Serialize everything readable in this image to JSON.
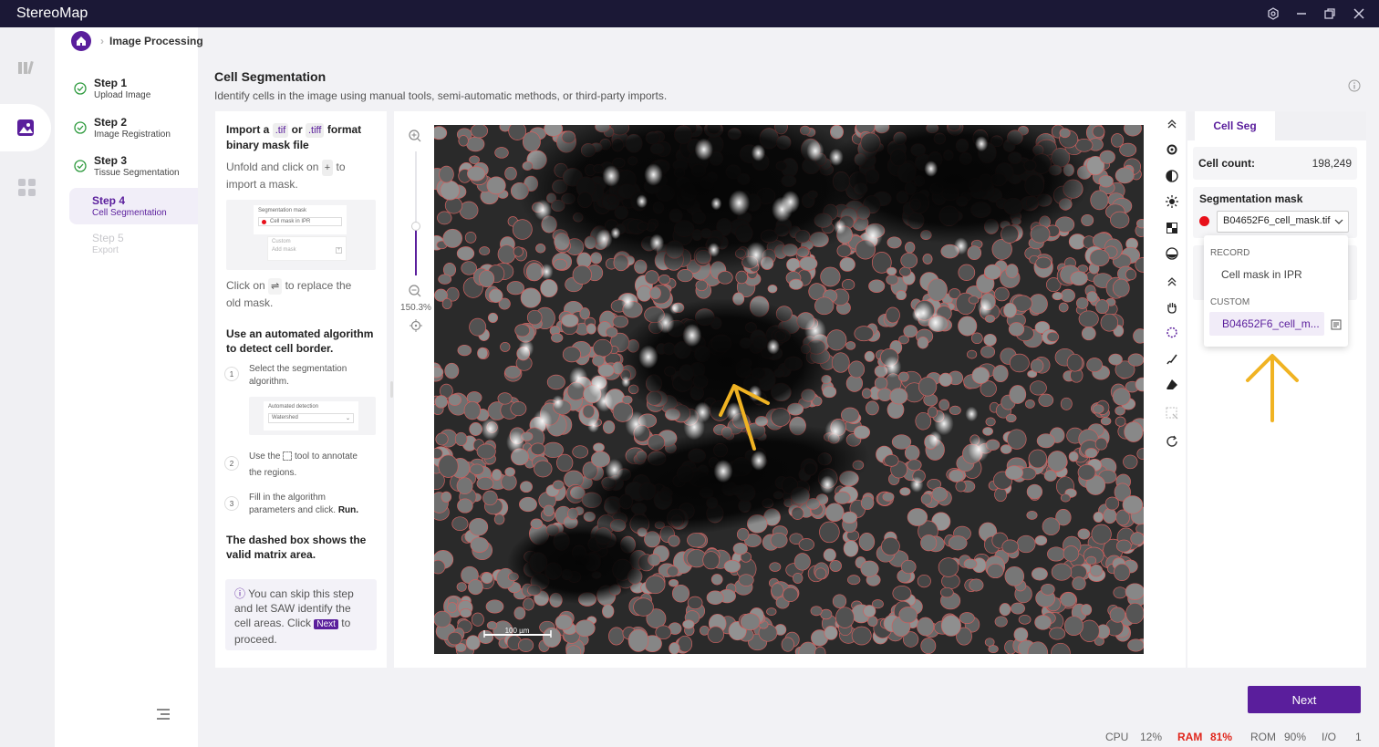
{
  "app": {
    "title": "StereoMap"
  },
  "breadcrumb": {
    "label": "Image Processing"
  },
  "steps": [
    {
      "title": "Step 1",
      "subtitle": "Upload Image"
    },
    {
      "title": "Step 2",
      "subtitle": "Image Registration"
    },
    {
      "title": "Step 3",
      "subtitle": "Tissue Segmentation"
    },
    {
      "title": "Step 4",
      "subtitle": "Cell Segmentation"
    },
    {
      "title": "Step 5",
      "subtitle": "Export"
    }
  ],
  "page": {
    "title": "Cell Segmentation",
    "subtitle": "Identify cells in the image using manual tools, semi-automatic methods, or third-party imports."
  },
  "guide": {
    "import_a": "Import a",
    "ext1": ".tif",
    "or": "or",
    "ext2": ".tiff",
    "format": "format",
    "binary": "binary mask file",
    "unfold_a": "Unfold and click on",
    "unfold_plus": "+",
    "unfold_b": "to",
    "unfold_c": "import a mask.",
    "mini_mask_title": "Segmentation mask",
    "mini_mask_opt": "Cell mask in IPR",
    "mini_custom": "Custom",
    "mini_add": "Add mask",
    "click_on": "Click on",
    "swap": "⇌",
    "replace_a": "to replace the",
    "replace_b": "old mask.",
    "auto_a": "Use an automated algorithm",
    "auto_b": "to detect cell border.",
    "s1_num": "1",
    "s1_a": "Select the segmentation",
    "s1_b": "algorithm.",
    "mini_auto": "Automated detection",
    "mini_ws": "Watershed",
    "s2_num": "2",
    "s2_a": "Use the",
    "s2_b": "tool to annotate",
    "s2_c": "the regions.",
    "s3_num": "3",
    "s3_a": "Fill in the algorithm",
    "s3_b": "parameters and click.",
    "s3_run": "Run.",
    "dashed_a": "The dashed box shows the",
    "dashed_b": "valid matrix area.",
    "note_a": "You can skip this step",
    "note_b": "and let SAW identify the",
    "note_c": "cell areas. Click",
    "note_next": "Next",
    "note_d": "to",
    "note_e": "proceed."
  },
  "zoom": {
    "level": "150.3%",
    "fill": 0.4
  },
  "viewer": {
    "scalebar": "100 µm"
  },
  "right": {
    "tab": "Cell Seg",
    "cell_count_label": "Cell count:",
    "cell_count": "198,249",
    "mask_label": "Segmentation mask",
    "mask_value": "B04652F6_cell_mask.tif",
    "record_label": "RECORD",
    "record_item": "Cell mask in IPR",
    "custom_label": "CUSTOM",
    "custom_item": "B04652F6_cell_m..."
  },
  "footer": {
    "next": "Next",
    "cpu_label": "CPU",
    "cpu": "12%",
    "ram_label": "RAM",
    "ram": "81%",
    "rom_label": "ROM",
    "rom": "90%",
    "io_label": "I/O",
    "io": "1"
  },
  "colors": {
    "accent": "#5a1e9c",
    "titlebar": "#1b1836",
    "ram_alert": "#e0261c",
    "mask_dot": "#e8101a",
    "arrow": "#f0b323"
  }
}
